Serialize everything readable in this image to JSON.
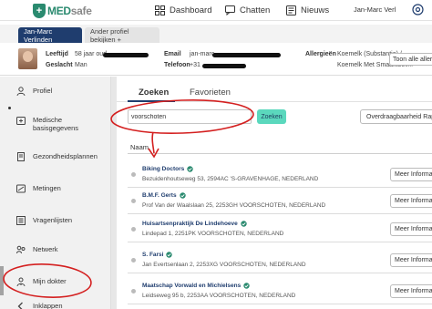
{
  "header": {
    "logo_text_a": "MED",
    "logo_text_b": "safe",
    "nav": [
      {
        "label": "Dashboard",
        "icon": "dashboard-icon"
      },
      {
        "label": "Chatten",
        "icon": "chat-icon"
      },
      {
        "label": "Nieuws",
        "icon": "news-icon"
      }
    ],
    "user_name": "Jan-Marc Verl",
    "settings_icon": "settings-icon"
  },
  "profile_tabs": {
    "active": "Jan-Marc Verlinden",
    "other": "Ander profiel bekijken +"
  },
  "patient": {
    "labels": {
      "age": "Leeftijd",
      "gender": "Geslacht",
      "email": "Email",
      "phone": "Telefoon",
      "allergies": "Allergieën"
    },
    "age_value": "58 jaar oud",
    "gender_value": "Man",
    "email_value": "jan-marc",
    "phone_value": "+31",
    "allergies": [
      "Koemelk (Substantie) /",
      "Koemelk Met Smaaktoev..."
    ],
    "allergy_button": "Toon alle allergieën"
  },
  "sidebar": {
    "items": [
      {
        "label": "Profiel",
        "icon": "person-icon"
      },
      {
        "label": "Medische basisgegevens",
        "icon": "medical-icon"
      },
      {
        "label": "Gezondheidsplannen",
        "icon": "plan-icon"
      },
      {
        "label": "Metingen",
        "icon": "measure-icon"
      },
      {
        "label": "Vragenlijsten",
        "icon": "list-icon"
      },
      {
        "label": "Netwerk",
        "icon": "network-icon"
      },
      {
        "label": "Mijn dokter",
        "icon": "doctor-icon"
      },
      {
        "label": "Inklappen",
        "icon": "collapse-icon"
      }
    ]
  },
  "main": {
    "tabs": [
      "Zoeken",
      "Favorieten"
    ],
    "search_value": "voorschoten",
    "search_button": "Zoeken",
    "transfer_button": "Overdraagbaarheid Rapp",
    "column_name": "Naam",
    "more_label": "Meer Informat",
    "results": [
      {
        "name": "Biking Doctors",
        "address": "Bezuidenhoutseweg 53, 2594AC 'S-GRAVENHAGE, NEDERLAND"
      },
      {
        "name": "B.M.F. Gerts",
        "address": "Prof Van der Waalslaan 25, 2253GH VOORSCHOTEN, NEDERLAND"
      },
      {
        "name": "Huisartsenpraktijk De Lindehoeve",
        "address": "Lindepad 1, 2251PK VOORSCHOTEN, NEDERLAND"
      },
      {
        "name": "S. Farsi",
        "address": "Jan Evertsenlaan 2, 2253XG VOORSCHOTEN, NEDERLAND"
      },
      {
        "name": "Maatschap Vorwald en Michielsens",
        "address": "Leidseweg 95 b, 2253AA VOORSCHOTEN, NEDERLAND"
      }
    ]
  },
  "colors": {
    "brand": "#2a8a6f",
    "navy": "#1f3d6e",
    "search_button": "#5bd8bd",
    "annotation_red": "#d42020"
  }
}
